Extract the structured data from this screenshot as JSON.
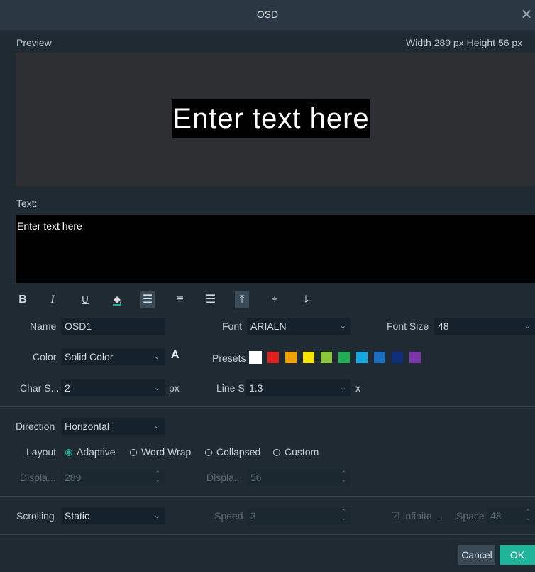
{
  "window": {
    "title": "OSD",
    "close_glyph": "✕"
  },
  "preview": {
    "label": "Preview",
    "size_text": "Width 289 px Height 56 px",
    "sample_text": "Enter text here"
  },
  "text": {
    "label": "Text:",
    "value": "Enter text here"
  },
  "toolbar": {
    "bold": "B",
    "italic": "I",
    "underline": "U",
    "fill_icon": "paint-bucket-icon",
    "align_left": "☰",
    "align_center": "≡",
    "align_right": "☰",
    "valign_top": "⤒",
    "valign_middle": "÷",
    "valign_bottom": "⤓"
  },
  "form": {
    "name_label": "Name",
    "name_value": "OSD1",
    "font_label": "Font",
    "font_value": "ARIALN",
    "font_size_label": "Font Size",
    "font_size_value": "48",
    "color_label": "Color",
    "color_value": "Solid Color",
    "color_icon": "A",
    "presets_label": "Presets",
    "presets": [
      "#ffffff",
      "#e01f1f",
      "#f2a200",
      "#f5e400",
      "#8cc63f",
      "#1fae52",
      "#17a7e0",
      "#1a6fc0",
      "#0f2f78",
      "#7a36a8"
    ],
    "char_spacing_label": "Char S...",
    "char_spacing_value": "2",
    "char_spacing_unit": "px",
    "line_spacing_label": "Line S...",
    "line_spacing_value": "1.3",
    "line_spacing_unit": "x",
    "direction_label": "Direction",
    "direction_value": "Horizontal",
    "layout_label": "Layout",
    "layout_options": [
      "Adaptive",
      "Word Wrap",
      "Collapsed",
      "Custom"
    ],
    "layout_selected": "Adaptive",
    "display_w_label": "Displa...",
    "display_w_value": "289",
    "display_h_label": "Displa...",
    "display_h_value": "56",
    "scrolling_label": "Scrolling",
    "scrolling_value": "Static",
    "speed_label": "Speed",
    "speed_value": "3",
    "infinite_label": "Infinite ...",
    "space_label": "Space",
    "space_value": "48"
  },
  "buttons": {
    "cancel": "Cancel",
    "ok": "OK"
  },
  "colors": {
    "accent": "#1fb39a",
    "background": "#1f2a33",
    "titlebar": "#2b3843"
  }
}
